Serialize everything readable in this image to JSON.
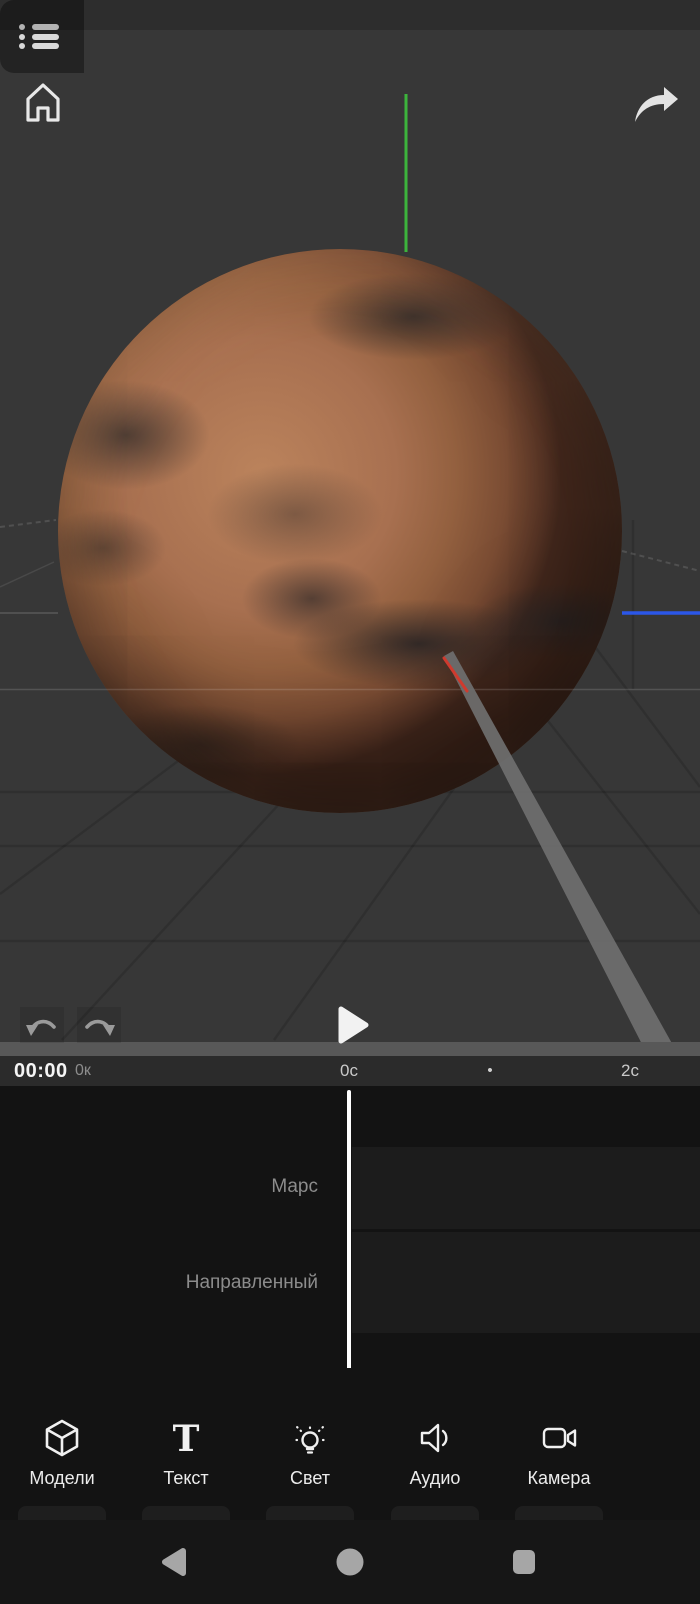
{
  "topbar": {
    "home_icon": "home-icon",
    "share_icon": "share-icon",
    "objects_list_icon": "list-icon"
  },
  "transport": {
    "undo_icon": "undo-icon",
    "redo_icon": "redo-icon",
    "play_icon": "play-icon"
  },
  "timeline": {
    "current_time": "00:00",
    "current_frame": "0к",
    "tick_start": "0с",
    "tick_middle_dot": "•",
    "tick_end": "2с"
  },
  "tracks": [
    {
      "name": "Марс"
    },
    {
      "name": "Направленный"
    }
  ],
  "toolbar": {
    "items": [
      {
        "label": "Модели",
        "icon": "cube-icon"
      },
      {
        "label": "Текст",
        "icon": "text-icon"
      },
      {
        "label": "Свет",
        "icon": "light-icon"
      },
      {
        "label": "Аудио",
        "icon": "audio-icon"
      },
      {
        "label": "Камера",
        "icon": "camera-icon"
      }
    ]
  },
  "navbar": {
    "back_icon": "back-icon",
    "home_icon": "nav-home-icon",
    "recents_icon": "recents-icon"
  },
  "colors": {
    "y_axis_green": "#3cb43c",
    "x_axis_blue": "#2b57e8",
    "light_beam_gray": "#6f6f6f",
    "beam_accent_red": "#cf3a2e",
    "playhead": "#ffffff",
    "viewport_bg": "#373737",
    "panel_bg": "#131313",
    "ruler_bg": "#2b2b2b"
  }
}
